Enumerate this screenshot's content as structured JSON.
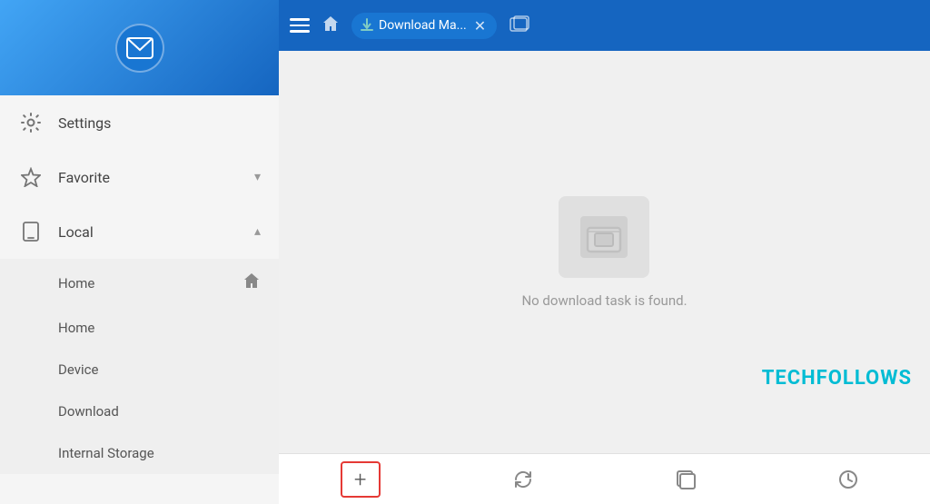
{
  "sidebar": {
    "header": {
      "icon": "mail-icon"
    },
    "nav_items": [
      {
        "id": "settings",
        "label": "Settings",
        "icon": "gear-icon",
        "expandable": false
      },
      {
        "id": "favorite",
        "label": "Favorite",
        "icon": "star-icon",
        "expandable": true,
        "expanded": false
      },
      {
        "id": "local",
        "label": "Local",
        "icon": "phone-icon",
        "expandable": true,
        "expanded": true
      }
    ],
    "sub_items": [
      {
        "id": "home1",
        "label": "Home",
        "has_icon": true
      },
      {
        "id": "home2",
        "label": "Home",
        "has_icon": false
      },
      {
        "id": "device",
        "label": "Device",
        "has_icon": false
      },
      {
        "id": "download",
        "label": "Download",
        "has_icon": false
      },
      {
        "id": "internal_storage",
        "label": "Internal Storage",
        "has_icon": false
      }
    ]
  },
  "topbar": {
    "tab_label": "Download Ma...",
    "home_tooltip": "Home"
  },
  "content": {
    "empty_message": "No download task is found."
  },
  "watermark": {
    "text": "TECHFOLLOWS",
    "color": "#00bcd4"
  },
  "bottom_toolbar": {
    "add_label": "+",
    "refresh_label": "↻",
    "layers_label": "⧉",
    "clock_label": "🕐"
  }
}
